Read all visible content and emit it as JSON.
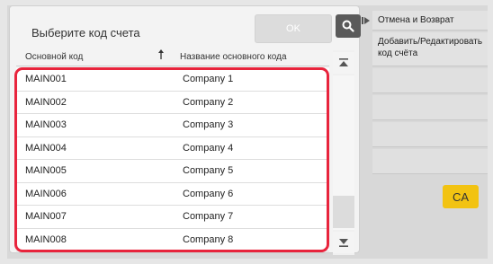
{
  "dialog": {
    "title": "Выберите код счета",
    "ok_label": "OK"
  },
  "table": {
    "columns": [
      "Основной код",
      "Название основного кода"
    ],
    "rows": [
      {
        "code": "MAIN001",
        "name": "Company 1"
      },
      {
        "code": "MAIN002",
        "name": "Company 2"
      },
      {
        "code": "MAIN003",
        "name": "Company 3"
      },
      {
        "code": "MAIN004",
        "name": "Company 4"
      },
      {
        "code": "MAIN005",
        "name": "Company 5"
      },
      {
        "code": "MAIN006",
        "name": "Company 6"
      },
      {
        "code": "MAIN007",
        "name": "Company 7"
      },
      {
        "code": "MAIN008",
        "name": "Company 8"
      }
    ]
  },
  "side_panel": {
    "items": [
      "Отмена и Возврат",
      "Добавить/Редактировать код счёта"
    ]
  },
  "ca_label": "CA",
  "colors": {
    "highlight": "#e8243c",
    "ca_button": "#f2c312",
    "search_button": "#5a5a5a"
  },
  "icons": [
    "search-icon",
    "play-icon",
    "sort-arrow-icon",
    "scroll-up-icon",
    "scroll-down-icon"
  ]
}
